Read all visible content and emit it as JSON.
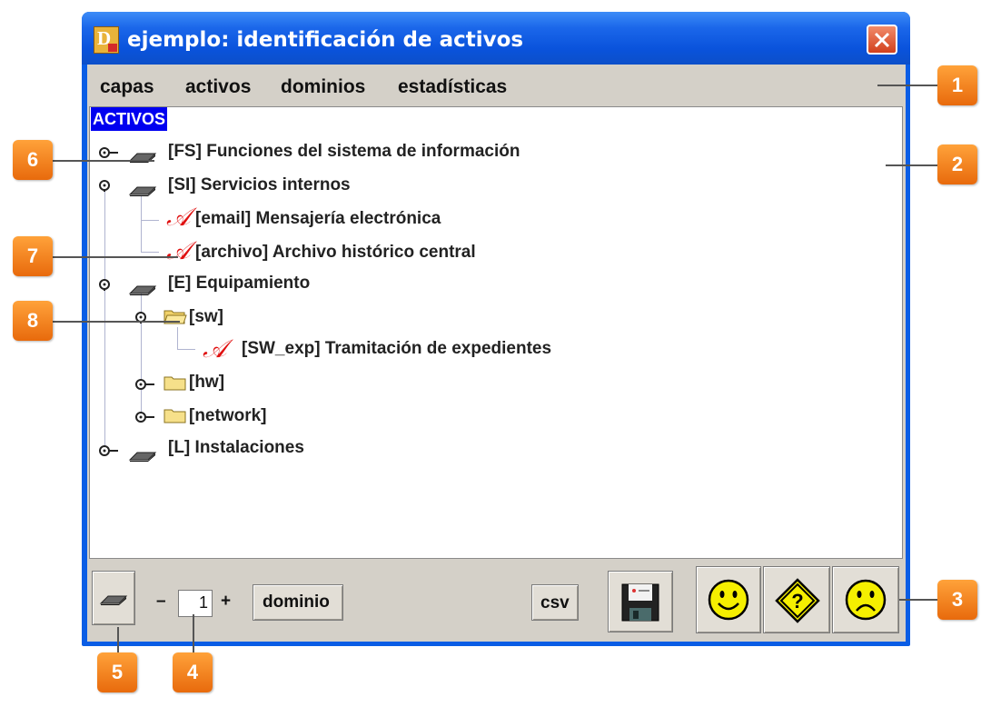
{
  "window": {
    "title": "ejemplo: identificación de activos",
    "close_label": "close"
  },
  "menu": {
    "items": [
      "capas",
      "activos",
      "dominios",
      "estadísticas"
    ]
  },
  "tree": {
    "root_label": "ACTIVOS",
    "nodes": [
      {
        "label": "[FS] Funciones del sistema de información",
        "icon": "layer-icon"
      },
      {
        "label": "[SI] Servicios internos",
        "icon": "layer-icon"
      },
      {
        "label": "[email] Mensajería electrónica",
        "icon": "asset-icon"
      },
      {
        "label": "[archivo] Archivo histórico central",
        "icon": "asset-icon"
      },
      {
        "label": "[E] Equipamiento",
        "icon": "layer-icon"
      },
      {
        "label": "[sw]",
        "icon": "folder-open-icon"
      },
      {
        "label": "[SW_exp] Tramitación de expedientes",
        "icon": "asset-icon"
      },
      {
        "label": "[hw]",
        "icon": "folder-icon"
      },
      {
        "label": "[network]",
        "icon": "folder-icon"
      },
      {
        "label": "[L] Instalaciones",
        "icon": "layer-icon"
      }
    ]
  },
  "toolbar": {
    "minus_label": "–",
    "level_value": "1",
    "plus_label": "+",
    "domain_button": "dominio",
    "csv_button": "csv"
  },
  "callouts": [
    "1",
    "2",
    "3",
    "4",
    "5",
    "6",
    "7",
    "8"
  ],
  "colors": {
    "title_bar": "#0a53dc",
    "selection": "#0000f0",
    "callout": "#f08a1c",
    "asset_icon": "#e01010",
    "smiley": "#f5ef00"
  }
}
